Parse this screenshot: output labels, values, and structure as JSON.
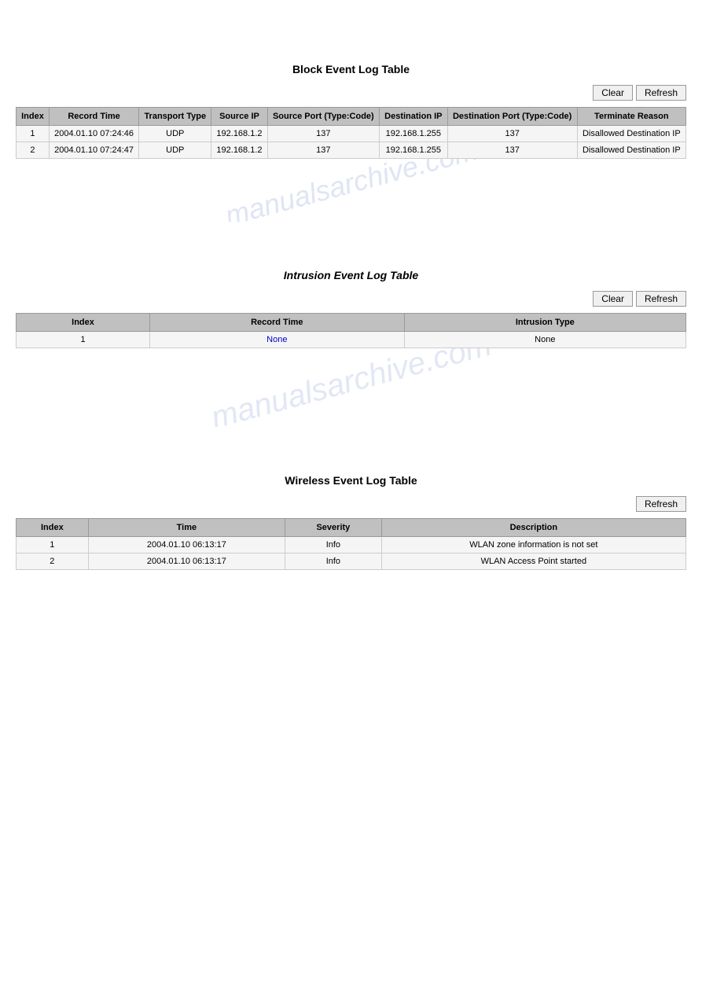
{
  "block_table": {
    "title": "Block Event Log Table",
    "buttons": {
      "clear": "Clear",
      "refresh": "Refresh"
    },
    "columns": [
      "Index",
      "Record Time",
      "Transport Type",
      "Source IP",
      "Source Port (Type:Code)",
      "Destination IP",
      "Destination Port (Type:Code)",
      "Terminate Reason"
    ],
    "rows": [
      {
        "index": "1",
        "record_time": "2004.01.10 07:24:46",
        "transport_type": "UDP",
        "source_ip": "192.168.1.2",
        "source_port": "137",
        "destination_ip": "192.168.1.255",
        "destination_port": "137",
        "terminate_reason": "Disallowed Destination IP"
      },
      {
        "index": "2",
        "record_time": "2004.01.10 07:24:47",
        "transport_type": "UDP",
        "source_ip": "192.168.1.2",
        "source_port": "137",
        "destination_ip": "192.168.1.255",
        "destination_port": "137",
        "terminate_reason": "Disallowed Destination IP"
      }
    ]
  },
  "intrusion_table": {
    "title": "Intrusion Event Log Table",
    "buttons": {
      "clear": "Clear",
      "refresh": "Refresh"
    },
    "columns": [
      "Index",
      "Record Time",
      "Intrusion Type"
    ],
    "rows": [
      {
        "index": "1",
        "record_time": "None",
        "intrusion_type": "None"
      }
    ]
  },
  "wireless_table": {
    "title": "Wireless Event Log Table",
    "buttons": {
      "refresh": "Refresh"
    },
    "columns": [
      "Index",
      "Time",
      "Severity",
      "Description"
    ],
    "rows": [
      {
        "index": "1",
        "time": "2004.01.10 06:13:17",
        "severity": "Info",
        "description": "WLAN zone information is not set"
      },
      {
        "index": "2",
        "time": "2004.01.10 06:13:17",
        "severity": "Info",
        "description": "WLAN Access Point started"
      }
    ]
  }
}
